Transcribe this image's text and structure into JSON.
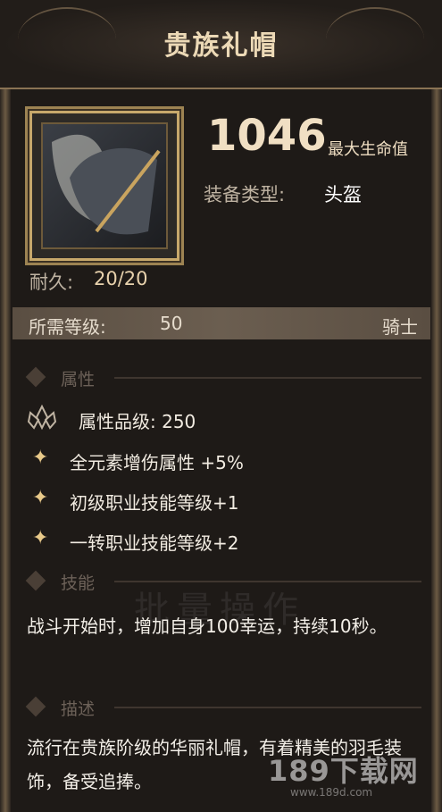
{
  "item": {
    "name": "贵族礼帽",
    "stat_value": "1046",
    "stat_name": "最大生命值",
    "type_label": "装备类型:",
    "type_value": "头盔",
    "durability_label": "耐久:",
    "durability_value": "20/20",
    "level_label": "所需等级:",
    "level_value": "50",
    "class_value": "骑士"
  },
  "attributes": {
    "header": "属性",
    "grade": "属性品级: 250",
    "lines": [
      "全元素增伤属性 +5%",
      "初级职业技能等级+1",
      "一转职业技能等级+2"
    ]
  },
  "skill": {
    "header": "技能",
    "text": "战斗开始时，增加自身100幸运，持续10秒。"
  },
  "description": {
    "header": "描述",
    "text": "流行在贵族阶级的华丽礼帽，有着精美的羽毛装饰，备受追捧。"
  },
  "background": {
    "ghost_text": "批量操作"
  },
  "watermark": {
    "main": "189下载网",
    "sub": "www.189d.com"
  },
  "colors": {
    "accent_gold": "#c7a86b",
    "bg": "#1e1a17"
  }
}
